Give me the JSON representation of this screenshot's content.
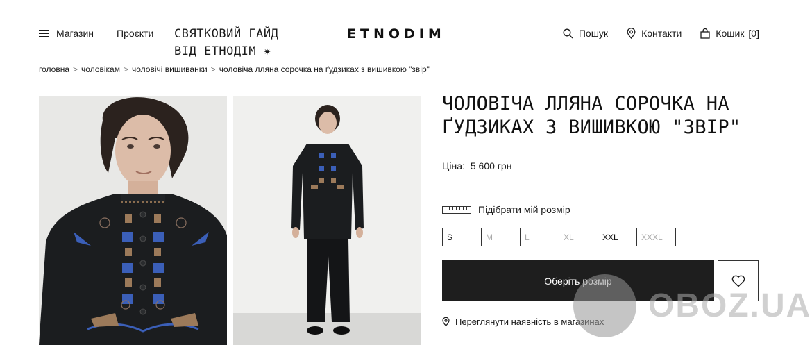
{
  "header": {
    "menu_label": "Магазин",
    "projects_label": "Проєкти",
    "promo_line1": "СВЯТКОВИЙ ГАЙД",
    "promo_line2": "ВІД ЕТНОДІМ ✷",
    "logo": "ETNODIM",
    "search_label": "Пошук",
    "contacts_label": "Контакти",
    "cart_label": "Кошик",
    "cart_count": "[0]"
  },
  "breadcrumb": {
    "items": [
      "головна",
      "чоловікам",
      "чоловічі вишиванки",
      "чоловіча лляна сорочка на ґудзиках з вишивкою \"звір\""
    ],
    "separator": ">"
  },
  "product": {
    "title": "ЧОЛОВІЧА ЛЛЯНА СОРОЧКА НА ҐУДЗИКАХ З ВИШИВКОЮ \"ЗВІР\"",
    "price_label": "Ціна:",
    "price_value": "5 600 грн",
    "size_guide_label": "Підібрати мій розмір",
    "sizes": [
      {
        "label": "S",
        "available": true
      },
      {
        "label": "M",
        "available": false
      },
      {
        "label": "L",
        "available": false
      },
      {
        "label": "XL",
        "available": false
      },
      {
        "label": "XXL",
        "available": true
      },
      {
        "label": "XXXL",
        "available": false
      }
    ],
    "cta_label": "Оберіть розмір",
    "stores_label": "Переглянути наявність в магазинах"
  },
  "watermark": {
    "text": "OBOZ.UA"
  },
  "colors": {
    "text": "#1a1a1a",
    "cta_bg": "#1e1e1e",
    "shirt": "#1b1d1f",
    "embroidery_blue": "#3b5fb8",
    "embroidery_brown": "#9c7a5a"
  }
}
